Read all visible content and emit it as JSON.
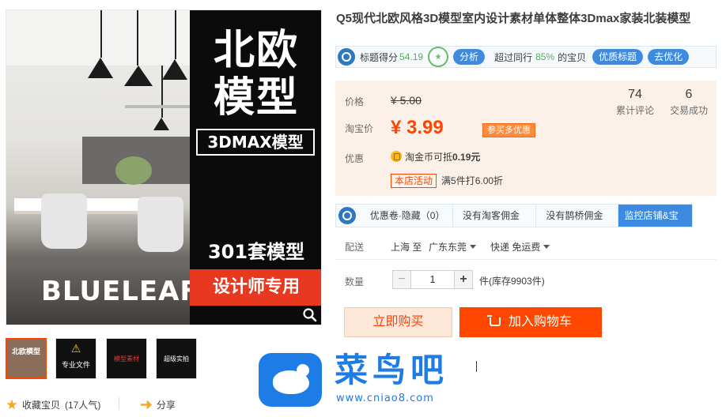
{
  "gallery": {
    "watermark_text": "BLUELEAF",
    "panel_line1": "北欧",
    "panel_line2": "模型",
    "panel_box": "3DMAX模型",
    "panel_count": "301套模型",
    "panel_banner": "设计师专用",
    "thumbs": [
      {
        "text": "北欧模型"
      },
      {
        "text": "专业文件"
      },
      {
        "text": "模型素材"
      },
      {
        "text": "超级实拍"
      }
    ]
  },
  "actions": {
    "collect_label": "收藏宝贝",
    "collect_count": "(17人气)",
    "share_label": "分享"
  },
  "product": {
    "title": "Q5现代北欧风格3D模型室内设计素材单体整体3Dmax家装北装模型"
  },
  "score_bar": {
    "score_label": "标题得分",
    "score_value": "54.19",
    "analyze_label": "分析",
    "beyond_label": "超过同行",
    "beyond_value": "85%",
    "beyond_suffix": "的宝贝",
    "optimize_title_label": "优质标题",
    "go_optimize_label": "去优化"
  },
  "price": {
    "price_label": "价格",
    "original_price": "¥ 5.00",
    "taobao_label": "淘宝价",
    "sale_price": "¥ 3.99",
    "promo_tag": "参买多优惠",
    "reviews_count": "74",
    "reviews_label": "累计评论",
    "deals_count": "6",
    "deals_label": "交易成功",
    "discount_label": "优惠",
    "coin_text": "淘金币可抵",
    "coin_value": "0.19元",
    "shop_tag": "本店活动",
    "shop_offer": "满5件打6.00折"
  },
  "tabs": {
    "items": [
      "优惠卷·隐藏（0）",
      "没有淘客佣金",
      "没有鹊桥佣金",
      "监控店铺&宝贝"
    ]
  },
  "shipping": {
    "label": "配送",
    "from": "上海 至",
    "to": "广东东莞",
    "method": "快递 免运费"
  },
  "quantity": {
    "label": "数量",
    "minus": "−",
    "value": "1",
    "plus": "+",
    "stock": "件(库存9903件)"
  },
  "buttons": {
    "buy_now": "立即购买",
    "add_to_cart": "加入购物车"
  },
  "logo": {
    "name": "菜鸟吧",
    "url": "www.cniao8.com"
  },
  "colors": {
    "accent": "#ff4700",
    "price": "#ff4400",
    "blue": "#3d8be0",
    "logo_blue": "#1e7ce6"
  }
}
